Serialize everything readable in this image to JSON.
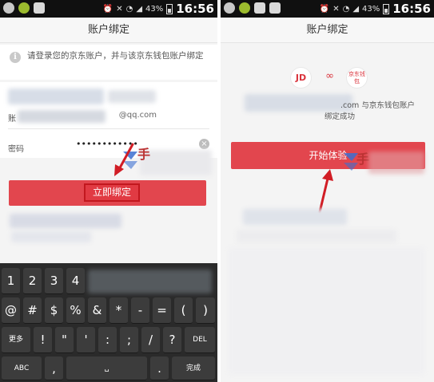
{
  "status_bar": {
    "battery": "43%",
    "time": "16:56"
  },
  "left_screen": {
    "title": "账户绑定",
    "notice": "请登录您的京东账户，并与该京东钱包账户绑定",
    "account": {
      "label": "账",
      "value": "@qq.com"
    },
    "password": {
      "label": "密码",
      "value": "••••••••••••"
    },
    "bind_button_label": "立即绑定",
    "watermark_char": "手",
    "keyboard": {
      "row1": [
        "1",
        "2",
        "3",
        "4"
      ],
      "row2": [
        "@",
        "#",
        "$",
        "%",
        "&",
        "*",
        "-",
        "=",
        "(",
        ")"
      ],
      "row3": [
        "更多",
        "!",
        "\"",
        "'",
        ":",
        ";",
        "/",
        "?",
        "DEL"
      ],
      "row4": [
        "ABC",
        ",",
        "␣",
        ".",
        "完成"
      ]
    }
  },
  "right_screen": {
    "title": "账户绑定",
    "logos": {
      "jd": "JD",
      "link": "∞",
      "wallet": "京东钱包"
    },
    "success_line1": ".com 与京东钱包账户",
    "success_line2": "绑定成功",
    "start_button_label": "开始体验",
    "watermark_char": "手"
  },
  "colors": {
    "accent": "#e2464e",
    "highlight_border": "#c2171e",
    "status_bar": "#101010"
  }
}
